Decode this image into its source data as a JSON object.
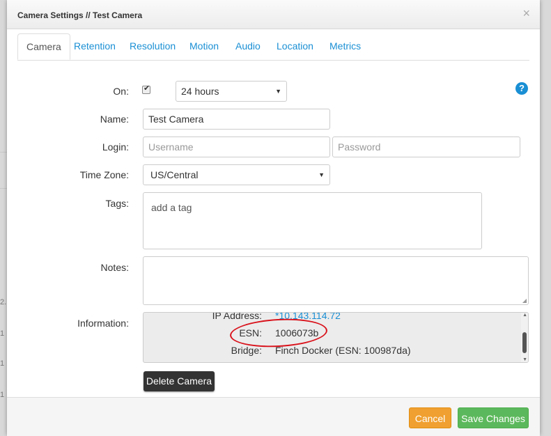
{
  "modal": {
    "title": "Camera Settings // Test Camera",
    "close_glyph": "×"
  },
  "tabs": [
    {
      "label": "Camera",
      "active": true
    },
    {
      "label": "Retention"
    },
    {
      "label": "Resolution"
    },
    {
      "label": "Motion"
    },
    {
      "label": "Audio"
    },
    {
      "label": "Location"
    },
    {
      "label": "Metrics"
    }
  ],
  "form": {
    "on_label": "On:",
    "on_checked": true,
    "schedule_value": "24 hours",
    "name_label": "Name:",
    "name_value": "Test Camera",
    "login_label": "Login:",
    "username_placeholder": "Username",
    "password_placeholder": "Password",
    "timezone_label": "Time Zone:",
    "timezone_value": "US/Central",
    "tags_label": "Tags:",
    "tags_placeholder": "add a tag",
    "notes_label": "Notes:",
    "information_label": "Information:",
    "help_icon": "question-circle-icon"
  },
  "information": [
    {
      "key": "IP Address:",
      "value": "*10.143.114.72",
      "link": true
    },
    {
      "key": "ESN:",
      "value": "1006073b"
    },
    {
      "key": "Bridge:",
      "value": "Finch Docker (ESN: 100987da)"
    }
  ],
  "buttons": {
    "delete_camera": "Delete Camera",
    "cancel": "Cancel",
    "save_changes": "Save Changes"
  },
  "background_glimpses": [
    "2.",
    "1",
    "1",
    "1"
  ],
  "colors": {
    "accent": "#1a8fd4",
    "cancel": "#f0a030",
    "save": "#5cb85c",
    "annotation": "#d9121b"
  }
}
